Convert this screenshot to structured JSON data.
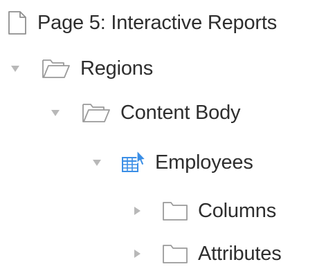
{
  "tree": {
    "page": {
      "label": "Page 5: Interactive Reports",
      "icon": "page-icon"
    },
    "regions": {
      "label": "Regions",
      "icon": "folder-open-icon",
      "state": "expanded"
    },
    "content_body": {
      "label": "Content Body",
      "icon": "folder-open-icon",
      "state": "expanded"
    },
    "employees": {
      "label": "Employees",
      "icon": "interactive-report-icon",
      "state": "expanded"
    },
    "columns": {
      "label": "Columns",
      "icon": "folder-icon",
      "state": "collapsed"
    },
    "attributes": {
      "label": "Attributes",
      "icon": "folder-icon",
      "state": "collapsed"
    }
  },
  "colors": {
    "text": "#2e2e2e",
    "icon_stroke": "#9a9a9a",
    "toggle": "#b8b8b8",
    "accent_blue": "#3a8ee6"
  }
}
